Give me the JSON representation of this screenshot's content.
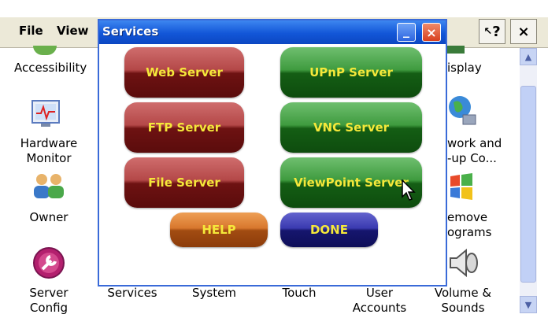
{
  "menubar": {
    "file_label": "File",
    "view_label": "View",
    "help_btn": "?",
    "close_btn": "×"
  },
  "desktop_icons": [
    {
      "label": "Accessibility",
      "icon": "accessibility-icon"
    },
    {
      "label_lines": [
        "Hardware",
        "Monitor"
      ],
      "icon": "hardware-monitor-icon"
    },
    {
      "label": "Owner",
      "icon": "owner-icon"
    },
    {
      "label_lines": [
        "Server",
        "Config"
      ],
      "icon": "server-config-icon"
    },
    {
      "label": "Services"
    },
    {
      "label": "System"
    },
    {
      "label": "Touch"
    },
    {
      "label_lines": [
        "User",
        "Accounts"
      ]
    },
    {
      "label": "isplay",
      "icon": "display-icon"
    },
    {
      "label_lines": [
        "work and",
        "-up Co..."
      ],
      "icon": "network-icon"
    },
    {
      "label_lines": [
        "emove",
        "ograms"
      ],
      "icon": "remove-programs-icon"
    },
    {
      "label_lines": [
        "Volume &",
        "Sounds"
      ],
      "icon": "volume-icon"
    }
  ],
  "dialog": {
    "title": "Services",
    "minimize": "_",
    "close": "×",
    "buttons": {
      "web_server": "Web Server",
      "upnp_server": "UPnP Server",
      "ftp_server": "FTP Server",
      "vnc_server": "VNC Server",
      "file_server": "File Server",
      "viewpoint_server": "ViewPoint Server",
      "help": "HELP",
      "done": "DONE"
    }
  },
  "colors": {
    "titlebar": "#1256d8",
    "button_text": "#f5e83a",
    "red_button": "#7a1a1a",
    "green_button": "#1e6e1e",
    "orange_button": "#c0641e",
    "blue_button": "#20208a"
  }
}
